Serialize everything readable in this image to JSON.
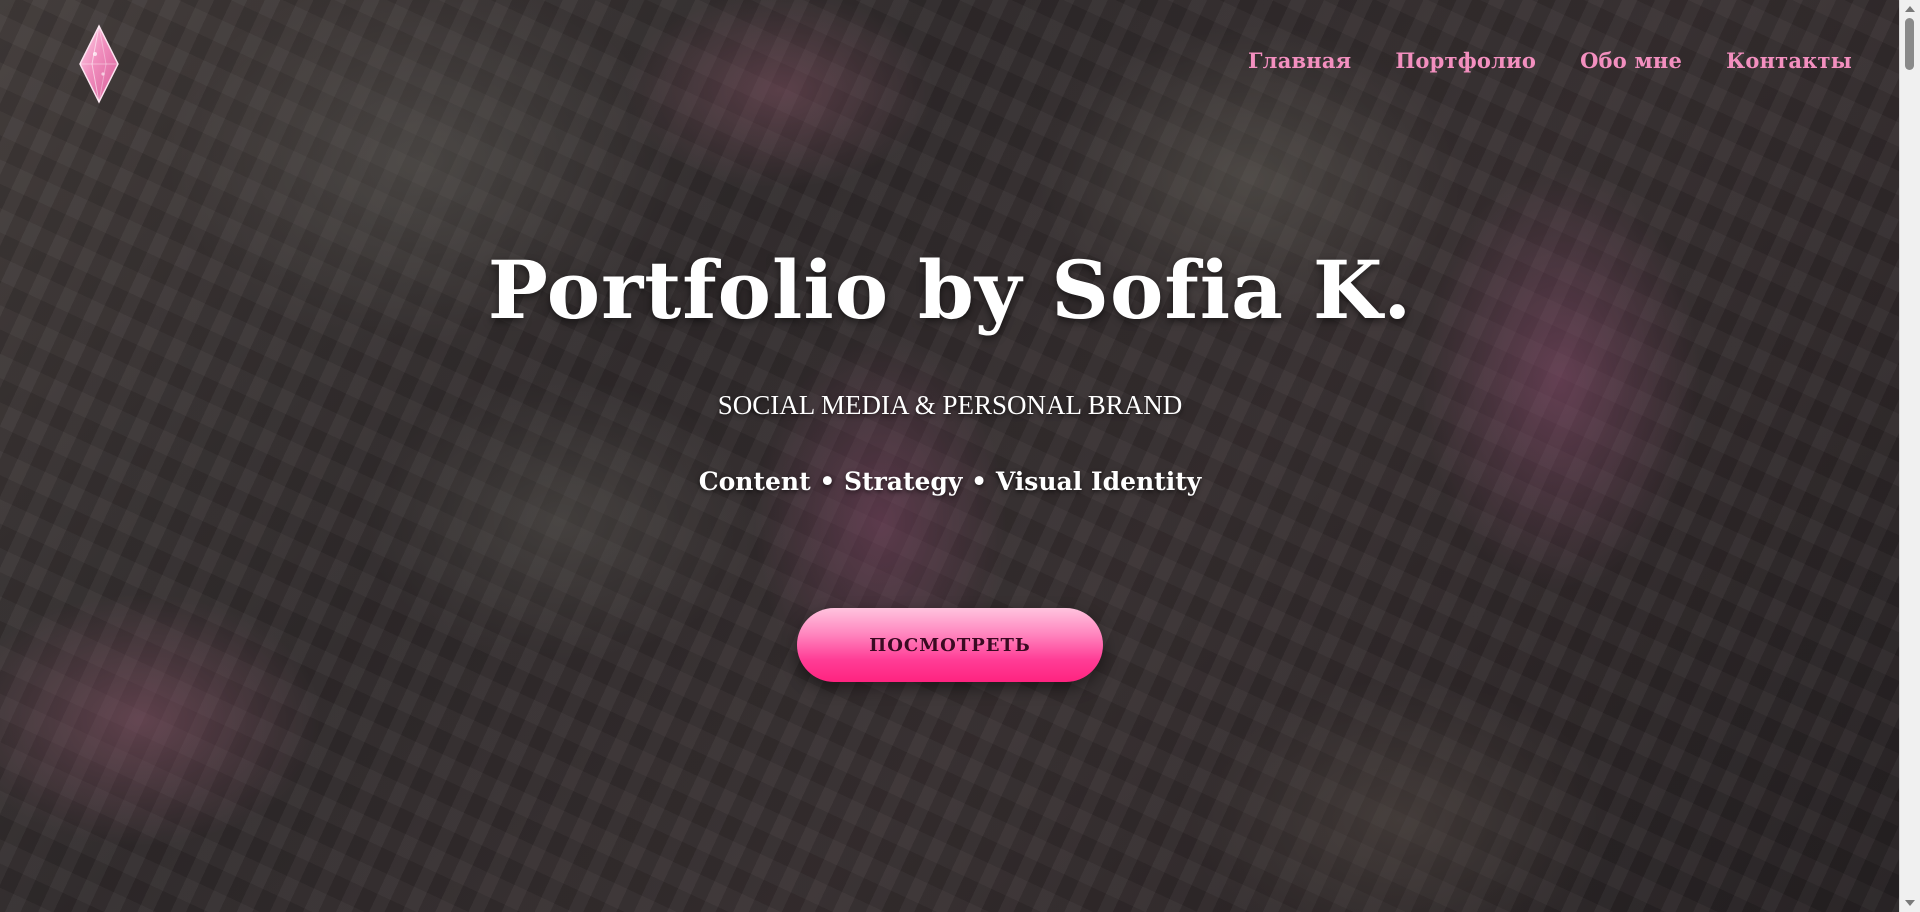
{
  "header": {
    "logo_icon": "pink-diamond-icon",
    "nav": [
      {
        "label": "Главная"
      },
      {
        "label": "Портфолио"
      },
      {
        "label": "Обо мне"
      },
      {
        "label": "Контакты"
      }
    ]
  },
  "hero": {
    "title": "Portfolio by Sofia K.",
    "subtitle": "SOCIAL MEDIA & PERSONAL BRAND",
    "tagline": "Content • Strategy • Visual Identity",
    "cta_label": "ПОСМОТРЕТЬ"
  },
  "colors": {
    "nav_link": "#f38fbf",
    "cta_top": "#ffc3de",
    "cta_bottom": "#ff2380",
    "cta_text": "#3a0a22",
    "title_text": "#ffffff"
  }
}
